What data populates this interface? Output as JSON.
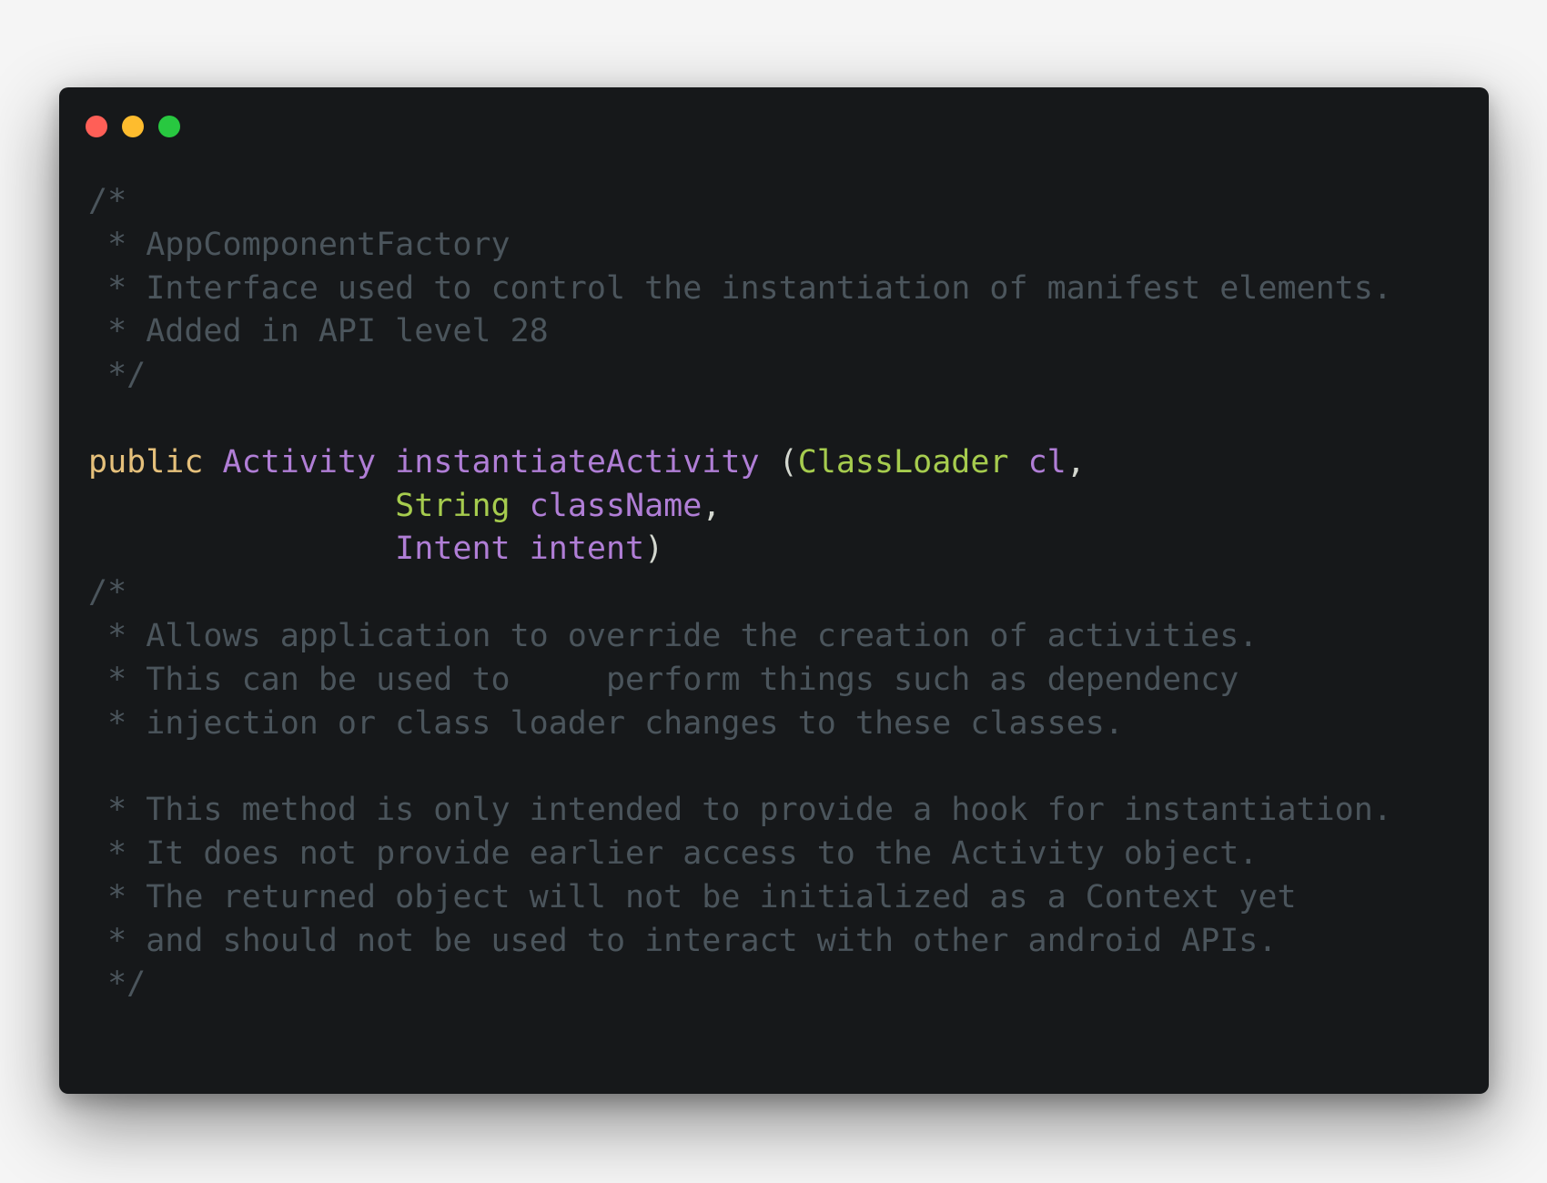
{
  "window": {
    "background": "#16181a",
    "buttons": [
      {
        "name": "close",
        "color": "#ff5f57"
      },
      {
        "name": "minimize",
        "color": "#febc2e"
      },
      {
        "name": "maximize",
        "color": "#28c840"
      }
    ]
  },
  "colors": {
    "comment": "#4b555c",
    "keyword": "#e5c07b",
    "type": "#b07ed6",
    "method": "#b07ed6",
    "param_type": "#a6cc4e",
    "param_name": "#b07ed6",
    "punct": "#d3d7cf"
  },
  "code": {
    "lines": [
      [
        {
          "t": "/*",
          "c": "comment"
        }
      ],
      [
        {
          "t": " * AppComponentFactory",
          "c": "comment"
        }
      ],
      [
        {
          "t": " * Interface used to control the instantiation of manifest elements.",
          "c": "comment"
        }
      ],
      [
        {
          "t": " * Added in API level 28",
          "c": "comment"
        }
      ],
      [
        {
          "t": " */",
          "c": "comment"
        }
      ],
      [],
      [
        {
          "t": "public",
          "c": "keyword"
        },
        {
          "t": " ",
          "c": "punct"
        },
        {
          "t": "Activity",
          "c": "type"
        },
        {
          "t": " ",
          "c": "punct"
        },
        {
          "t": "instantiateActivity",
          "c": "method"
        },
        {
          "t": " (",
          "c": "punct"
        },
        {
          "t": "ClassLoader",
          "c": "param_type"
        },
        {
          "t": " ",
          "c": "punct"
        },
        {
          "t": "cl",
          "c": "param_name"
        },
        {
          "t": ",",
          "c": "punct"
        }
      ],
      [
        {
          "t": "                ",
          "c": "punct"
        },
        {
          "t": "String",
          "c": "param_type"
        },
        {
          "t": " ",
          "c": "punct"
        },
        {
          "t": "className",
          "c": "param_name"
        },
        {
          "t": ",",
          "c": "punct"
        }
      ],
      [
        {
          "t": "                ",
          "c": "punct"
        },
        {
          "t": "Intent",
          "c": "type"
        },
        {
          "t": " ",
          "c": "punct"
        },
        {
          "t": "intent",
          "c": "param_name"
        },
        {
          "t": ")",
          "c": "punct"
        }
      ],
      [
        {
          "t": "/*",
          "c": "comment"
        }
      ],
      [
        {
          "t": " * Allows application to override the creation of activities.",
          "c": "comment"
        }
      ],
      [
        {
          "t": " * This can be used to     perform things such as dependency",
          "c": "comment"
        }
      ],
      [
        {
          "t": " * injection or class loader changes to these classes.",
          "c": "comment"
        }
      ],
      [],
      [
        {
          "t": " * This method is only intended to provide a hook for instantiation.",
          "c": "comment"
        }
      ],
      [
        {
          "t": " * It does not provide earlier access to the Activity object.",
          "c": "comment"
        }
      ],
      [
        {
          "t": " * The returned object will not be initialized as a Context yet",
          "c": "comment"
        }
      ],
      [
        {
          "t": " * and should not be used to interact with other android APIs.",
          "c": "comment"
        }
      ],
      [
        {
          "t": " */",
          "c": "comment"
        }
      ]
    ]
  }
}
